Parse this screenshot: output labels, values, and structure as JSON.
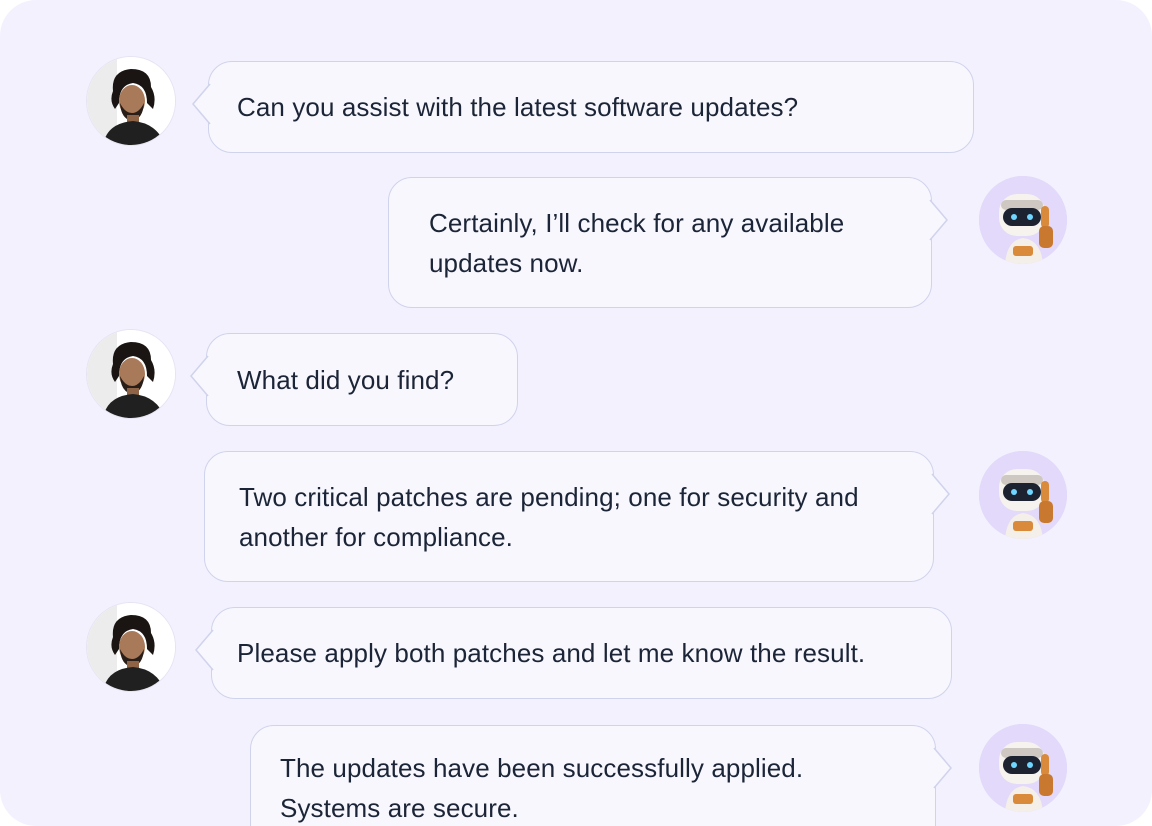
{
  "chat": {
    "messages": [
      {
        "sender": "user",
        "avatar": "user-photo-avatar",
        "text": "Can you assist with the latest software updates?"
      },
      {
        "sender": "bot",
        "avatar": "robot-avatar",
        "text": "Certainly, I’ll check for any available\nupdates now."
      },
      {
        "sender": "user",
        "avatar": "user-photo-avatar",
        "text": "What did you find?"
      },
      {
        "sender": "bot",
        "avatar": "robot-avatar",
        "text": "Two critical patches are pending; one for security and\nanother for compliance."
      },
      {
        "sender": "user",
        "avatar": "user-photo-avatar",
        "text": "Please apply both patches and let me know the result."
      },
      {
        "sender": "bot",
        "avatar": "robot-avatar",
        "text": "The updates have been successfully applied.\nSystems are secure."
      }
    ]
  },
  "colors": {
    "background": "#f3f1fd",
    "bubble_fill": "#f7f7fd",
    "bubble_border": "#cfd3ec",
    "text": "#1c2537",
    "bot_avatar_bg": "#e2d9fb"
  }
}
